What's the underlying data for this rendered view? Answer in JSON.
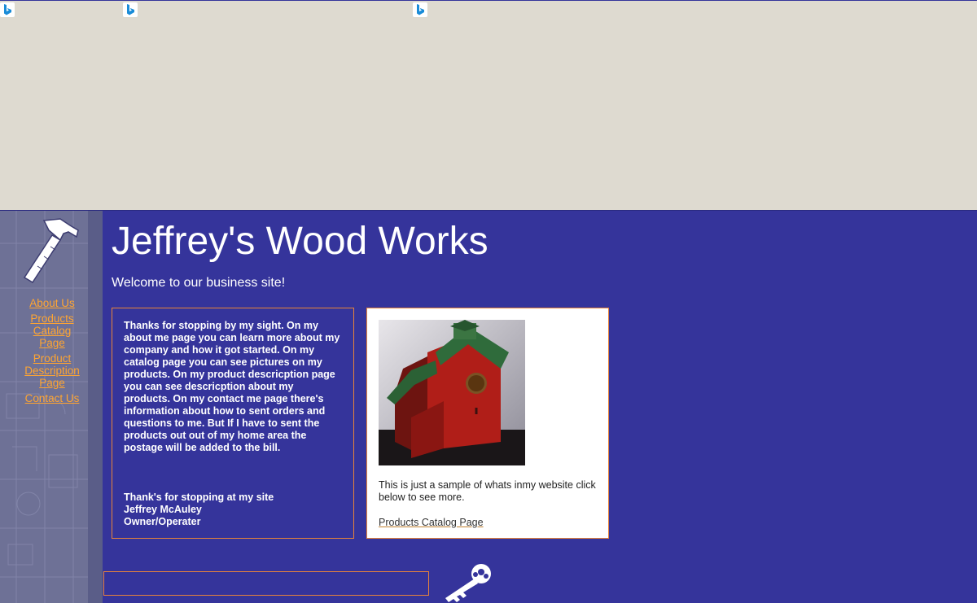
{
  "browser": {
    "icons": [
      "bing-icon",
      "bing-icon",
      "bing-icon"
    ]
  },
  "site": {
    "title": "Jeffrey's Wood Works",
    "welcome": "Welcome to our business site!",
    "nav": [
      {
        "label": "About Us"
      },
      {
        "label": "Products Catalog Page"
      },
      {
        "label": "Product Description Page"
      },
      {
        "label": "Contact Us"
      }
    ],
    "intro": {
      "body": "Thanks for stopping by my sight. On my about me page you can learn more about my company and how it got started. On my catalog page you can see pictures on my products. On my product descricption page you can see descricption about my products. On my contact me page there's information about how to sent orders and questions to me. But If I have to sent the products out out of my home area the postage will be added to the bill.",
      "sign_1": "Thank's for stopping at my site",
      "sign_2": "Jeffrey McAuley",
      "sign_3": "Owner/Operater"
    },
    "sample": {
      "text": "This is just a sample of whats inmy website click below to see more.",
      "link": "Products Catalog Page"
    }
  },
  "colors": {
    "page_bg": "#dedad0",
    "site_bg": "#35349b",
    "link": "#ffa531",
    "box_border": "#e8843a"
  }
}
